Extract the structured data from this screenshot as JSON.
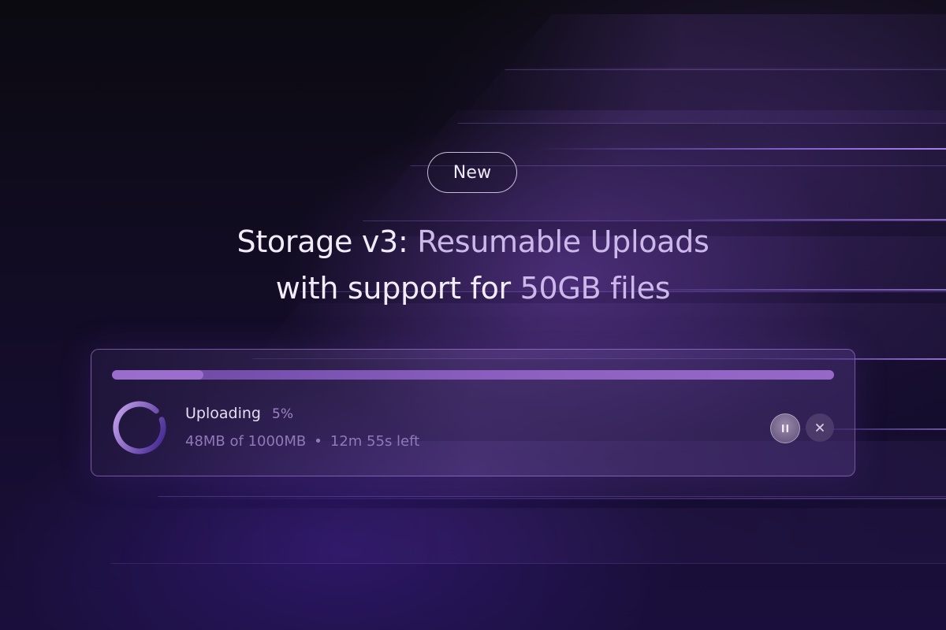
{
  "badge": {
    "label": "New"
  },
  "headline": {
    "line1_main": "Storage v3:",
    "line1_accent": "Resumable Uploads",
    "line2_main": "with support for",
    "line2_accent": "50GB files"
  },
  "upload": {
    "status_label": "Uploading",
    "percent_label": "5%",
    "progress_fraction": 0.05,
    "transferred": "48MB of 1000MB",
    "separator": "•",
    "time_left": "12m 55s left"
  },
  "controls": {
    "pause_icon": "pause-icon",
    "cancel_icon": "close-icon"
  },
  "colors": {
    "accent": "#b07de6",
    "ring_light": "#c9a6f0",
    "ring_dark": "#3a1f8a"
  }
}
